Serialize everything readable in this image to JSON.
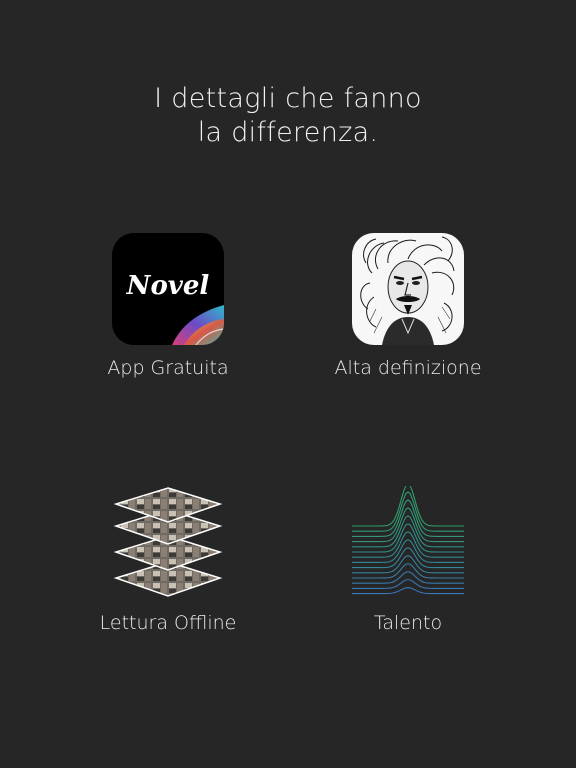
{
  "headline": {
    "line1": "I dettagli che fanno",
    "line2": "la differenza."
  },
  "features": [
    {
      "label": "App Gratuita",
      "icon": "novel-app-icon"
    },
    {
      "label": "Alta definizione",
      "icon": "sketch-portrait-icon"
    },
    {
      "label": "Lettura Offline",
      "icon": "stacked-pages-icon"
    },
    {
      "label": "Talento",
      "icon": "waveform-peak-icon"
    }
  ],
  "app_icon_text": "Novel",
  "colors": {
    "background": "#262626",
    "text": "#f2f2f2",
    "wave_top": "#2e9e6b",
    "wave_bottom": "#3b74b8"
  }
}
